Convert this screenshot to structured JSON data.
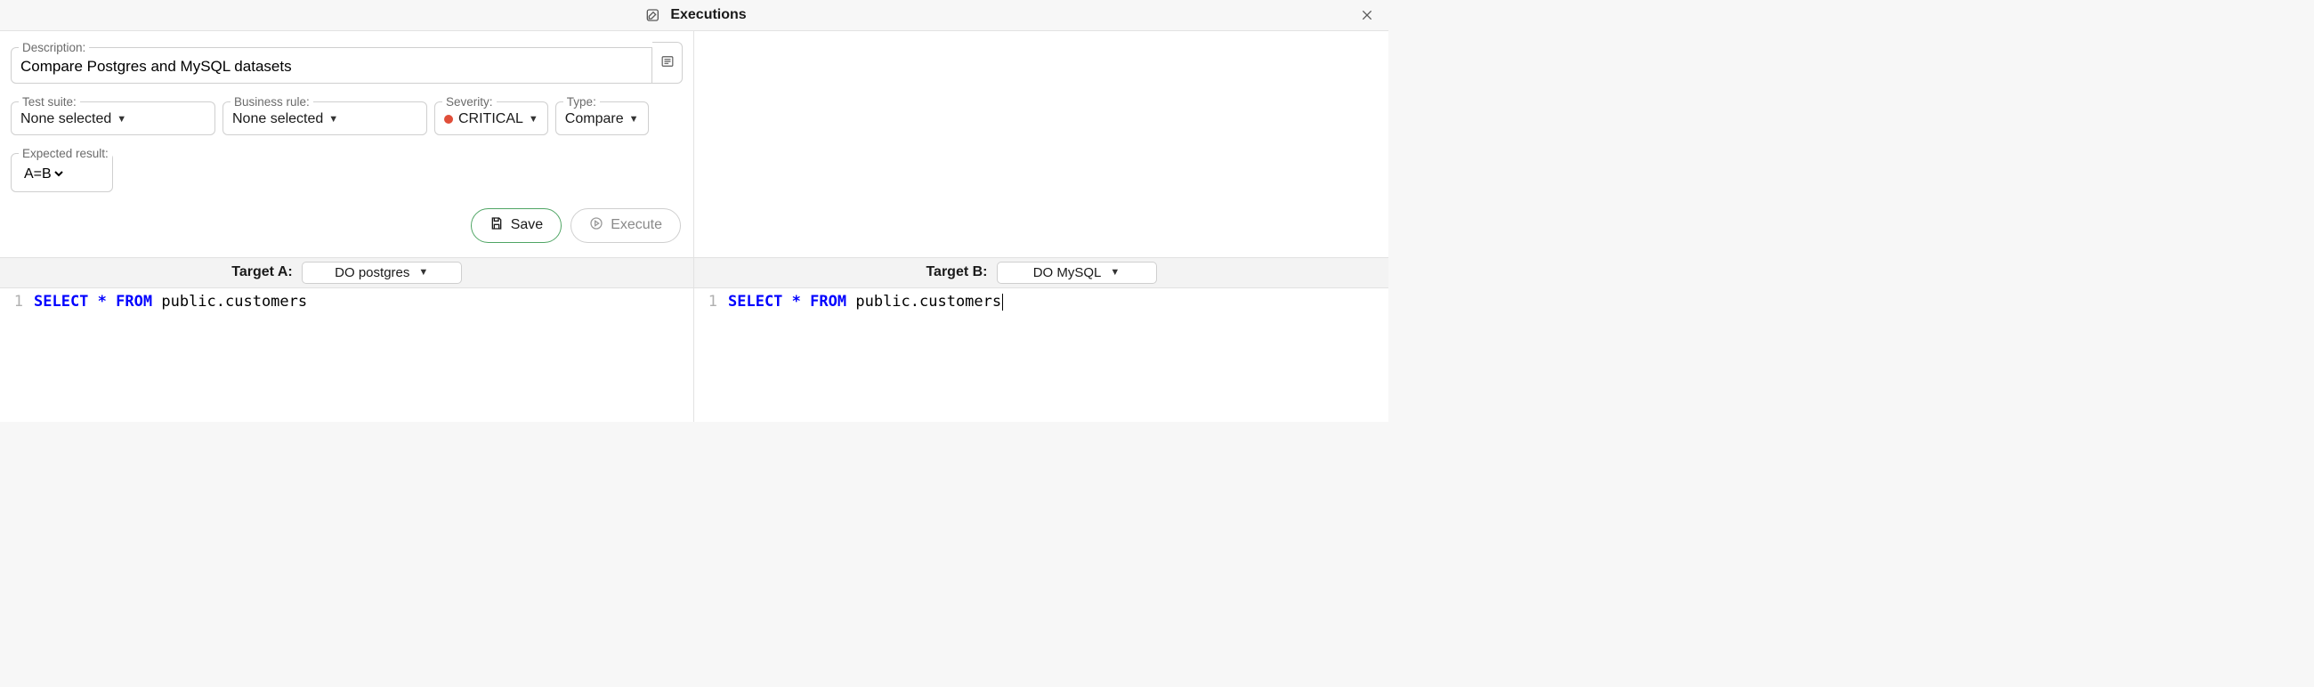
{
  "topbar": {
    "title": "Executions"
  },
  "form": {
    "description": {
      "label": "Description:",
      "value": "Compare Postgres and MySQL datasets"
    },
    "test_suite": {
      "label": "Test suite:",
      "value": "None selected"
    },
    "business_rule": {
      "label": "Business rule:",
      "value": "None selected"
    },
    "severity": {
      "label": "Severity:",
      "value": "CRITICAL",
      "color": "#e04e39"
    },
    "type": {
      "label": "Type:",
      "value": "Compare"
    },
    "expected": {
      "label": "Expected result:",
      "value": "A=B",
      "options": [
        "A=B"
      ]
    }
  },
  "actions": {
    "save": "Save",
    "execute": "Execute"
  },
  "targets": {
    "a": {
      "label": "Target A:",
      "value": "DO postgres"
    },
    "b": {
      "label": "Target B:",
      "value": "DO MySQL"
    }
  },
  "editors": {
    "a": {
      "line_no": "1",
      "kw1": "SELECT",
      "op": "*",
      "kw2": "FROM",
      "rest": " public.customers"
    },
    "b": {
      "line_no": "1",
      "kw1": "SELECT",
      "op": "*",
      "kw2": "FROM",
      "rest": " public.customers"
    }
  }
}
